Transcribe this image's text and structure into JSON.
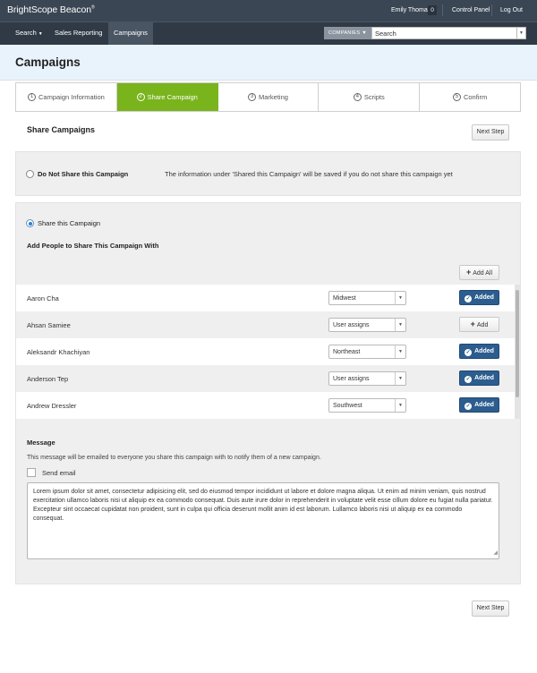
{
  "topbar": {
    "logo": "BrightScope Beacon",
    "logo_mark": "®",
    "user_name": "Emily Thomas",
    "notification_count": "0",
    "control_panel": "Control Panel",
    "log_out": "Log Out"
  },
  "nav": {
    "search": "Search",
    "sales_reporting": "Sales Reporting",
    "campaigns": "Campaigns",
    "company_filter": "COMPANIES",
    "search_placeholder": "Search"
  },
  "page": {
    "title": "Campaigns"
  },
  "steps": [
    {
      "num": "1",
      "label": "Campaign Information"
    },
    {
      "num": "2",
      "label": "Share Campaign"
    },
    {
      "num": "3",
      "label": "Marketing"
    },
    {
      "num": "4",
      "label": "Scripts"
    },
    {
      "num": "5",
      "label": "Confirm"
    }
  ],
  "share": {
    "section_title": "Share Campaigns",
    "next_step": "Next Step",
    "do_not_share": "Do Not Share this Campaign",
    "do_not_share_info": "The information under 'Shared this Campaign' will be saved if you do not share this campaign yet",
    "share_this": "Share this Campaign",
    "add_people": "Add People to Share This Campaign With",
    "add_all": "Add All"
  },
  "people": [
    {
      "name": "Aaron Cha",
      "region": "Midwest",
      "status": "Added"
    },
    {
      "name": "Ahsan Samiee",
      "region": "User assigns",
      "status": "Add"
    },
    {
      "name": "Aleksandr Khachiyan",
      "region": "Northeast",
      "status": "Added"
    },
    {
      "name": "Anderson Tep",
      "region": "User assigns",
      "status": "Added"
    },
    {
      "name": "Andrew Dressler",
      "region": "Southwest",
      "status": "Added"
    }
  ],
  "message": {
    "title": "Message",
    "description": "This message will be emailed to everyone you share this campaign with to notify them of a new campaign.",
    "send_email": "Send email",
    "body": "Lorem ipsum dolor sit amet, consectetur adipisicing elit, sed do eiusmod tempor incididunt ut labore et dolore magna aliqua. Ut enim ad minim veniam, quis nostrud exercitation ullamco laboris nisi ut aliquip ex ea commodo consequat. Duis aute irure dolor in reprehenderit in voluptate velit esse cillum dolore eu fugiat nulla pariatur. Excepteur sint occaecat cupidatat non proident, sunt in culpa qui officia deserunt mollit anim id est laborum. Lullamco laboris nisi ut aliquip ex ea commodo consequat."
  },
  "colors": {
    "topbar": "#3a4654",
    "active_step": "#79b41c",
    "added_button": "#2c5d8e",
    "header_bg": "#e9f3fb"
  }
}
